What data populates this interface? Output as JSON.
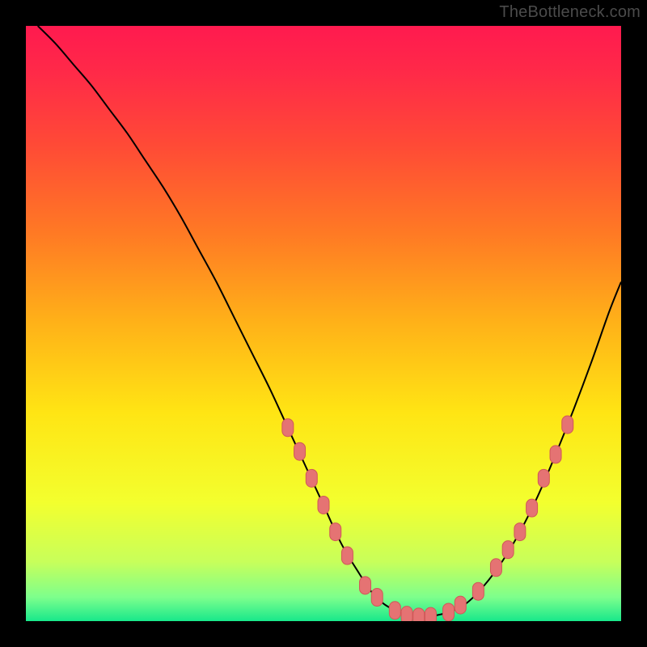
{
  "watermark": "TheBottleneck.com",
  "colors": {
    "background": "#000000",
    "gradient_stops": [
      {
        "offset": 0.0,
        "color": "#ff1a4f"
      },
      {
        "offset": 0.08,
        "color": "#ff2a48"
      },
      {
        "offset": 0.2,
        "color": "#ff4a36"
      },
      {
        "offset": 0.35,
        "color": "#ff7a24"
      },
      {
        "offset": 0.5,
        "color": "#ffb218"
      },
      {
        "offset": 0.65,
        "color": "#ffe514"
      },
      {
        "offset": 0.8,
        "color": "#f3ff2e"
      },
      {
        "offset": 0.9,
        "color": "#c8ff5a"
      },
      {
        "offset": 0.96,
        "color": "#7dff8c"
      },
      {
        "offset": 1.0,
        "color": "#18e88b"
      }
    ],
    "curve": "#000000",
    "marker_fill": "#e57373",
    "marker_stroke": "#d05858"
  },
  "chart_data": {
    "type": "line",
    "title": "",
    "xlabel": "",
    "ylabel": "",
    "xlim": [
      0,
      100
    ],
    "ylim": [
      0,
      100
    ],
    "grid": false,
    "series": [
      {
        "name": "bottleneck-curve",
        "x": [
          2,
          5,
          8,
          11,
          14,
          17,
          20,
          23,
          26,
          29,
          32,
          35,
          38,
          41,
          44,
          47,
          50,
          53,
          56,
          58,
          60,
          62,
          64,
          66,
          68,
          71,
          74,
          77,
          80,
          83,
          86,
          89,
          92,
          95,
          98,
          100
        ],
        "y": [
          100,
          97,
          93.5,
          90,
          86,
          82,
          77.5,
          73,
          68,
          62.5,
          57,
          51,
          45,
          39,
          32.5,
          26,
          19.5,
          13,
          8,
          5,
          3,
          1.8,
          1.0,
          0.7,
          0.8,
          1.5,
          3,
          6,
          10,
          15,
          21,
          28,
          35.5,
          43.5,
          52,
          57
        ]
      }
    ],
    "markers": {
      "name": "highlighted-points",
      "points": [
        {
          "x": 44,
          "y": 32.5
        },
        {
          "x": 46,
          "y": 28.5
        },
        {
          "x": 48,
          "y": 24
        },
        {
          "x": 50,
          "y": 19.5
        },
        {
          "x": 52,
          "y": 15
        },
        {
          "x": 54,
          "y": 11
        },
        {
          "x": 57,
          "y": 6
        },
        {
          "x": 59,
          "y": 4
        },
        {
          "x": 62,
          "y": 1.8
        },
        {
          "x": 64,
          "y": 1.0
        },
        {
          "x": 66,
          "y": 0.7
        },
        {
          "x": 68,
          "y": 0.8
        },
        {
          "x": 71,
          "y": 1.5
        },
        {
          "x": 73,
          "y": 2.7
        },
        {
          "x": 76,
          "y": 5
        },
        {
          "x": 79,
          "y": 9
        },
        {
          "x": 81,
          "y": 12
        },
        {
          "x": 83,
          "y": 15
        },
        {
          "x": 85,
          "y": 19
        },
        {
          "x": 87,
          "y": 24
        },
        {
          "x": 89,
          "y": 28
        },
        {
          "x": 91,
          "y": 33
        }
      ]
    }
  }
}
